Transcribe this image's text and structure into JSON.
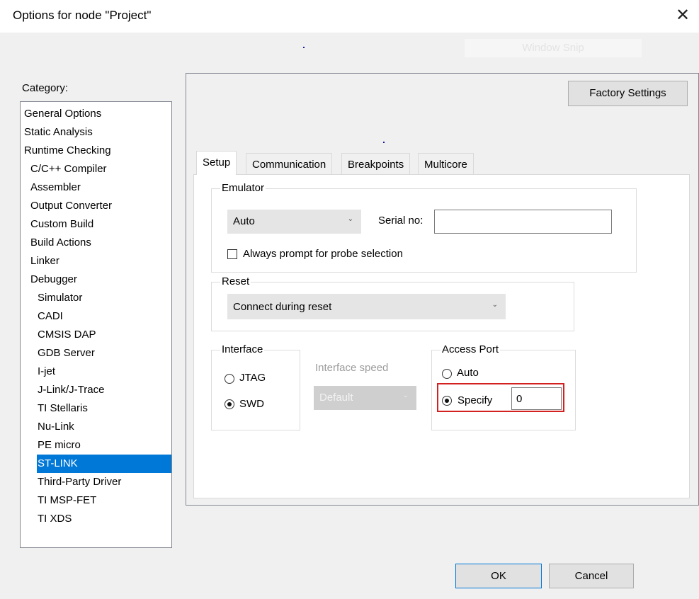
{
  "window": {
    "title": "Options for node \"Project\"",
    "close_icon": "close-icon",
    "ghost_button_label": "Window Snip"
  },
  "category": {
    "label": "Category:",
    "items": [
      {
        "label": "General Options",
        "level": 0
      },
      {
        "label": "Static Analysis",
        "level": 0
      },
      {
        "label": "Runtime Checking",
        "level": 0
      },
      {
        "label": "C/C++ Compiler",
        "level": 1
      },
      {
        "label": "Assembler",
        "level": 1
      },
      {
        "label": "Output Converter",
        "level": 1
      },
      {
        "label": "Custom Build",
        "level": 1
      },
      {
        "label": "Build Actions",
        "level": 1
      },
      {
        "label": "Linker",
        "level": 1
      },
      {
        "label": "Debugger",
        "level": 1
      },
      {
        "label": "Simulator",
        "level": 2
      },
      {
        "label": "CADI",
        "level": 2
      },
      {
        "label": "CMSIS DAP",
        "level": 2
      },
      {
        "label": "GDB Server",
        "level": 2
      },
      {
        "label": "I-jet",
        "level": 2
      },
      {
        "label": "J-Link/J-Trace",
        "level": 2
      },
      {
        "label": "TI Stellaris",
        "level": 2
      },
      {
        "label": "Nu-Link",
        "level": 2
      },
      {
        "label": "PE micro",
        "level": 2
      },
      {
        "label": "ST-LINK",
        "level": 2,
        "selected": true
      },
      {
        "label": "Third-Party Driver",
        "level": 2
      },
      {
        "label": "TI MSP-FET",
        "level": 2
      },
      {
        "label": "TI XDS",
        "level": 2
      }
    ]
  },
  "panel": {
    "factory_settings_label": "Factory Settings",
    "tabs": [
      "Setup",
      "Communication",
      "Breakpoints",
      "Multicore"
    ],
    "active_tab": "Setup"
  },
  "emulator": {
    "group_title": "Emulator",
    "selected": "Auto",
    "serial_label": "Serial no:",
    "serial_value": "",
    "always_prompt_label": "Always prompt for probe selection",
    "always_prompt_checked": false
  },
  "reset": {
    "group_title": "Reset",
    "selected": "Connect during reset"
  },
  "interface": {
    "group_title": "Interface",
    "options": [
      "JTAG",
      "SWD"
    ],
    "selected": "SWD",
    "speed_label": "Interface speed",
    "speed_value": "Default"
  },
  "access_port": {
    "group_title": "Access Port",
    "auto_label": "Auto",
    "specify_label": "Specify",
    "selected": "Specify",
    "value": "0"
  },
  "footer": {
    "ok_label": "OK",
    "cancel_label": "Cancel"
  },
  "colors": {
    "selection": "#0078d7",
    "highlight_border": "#d32020"
  }
}
